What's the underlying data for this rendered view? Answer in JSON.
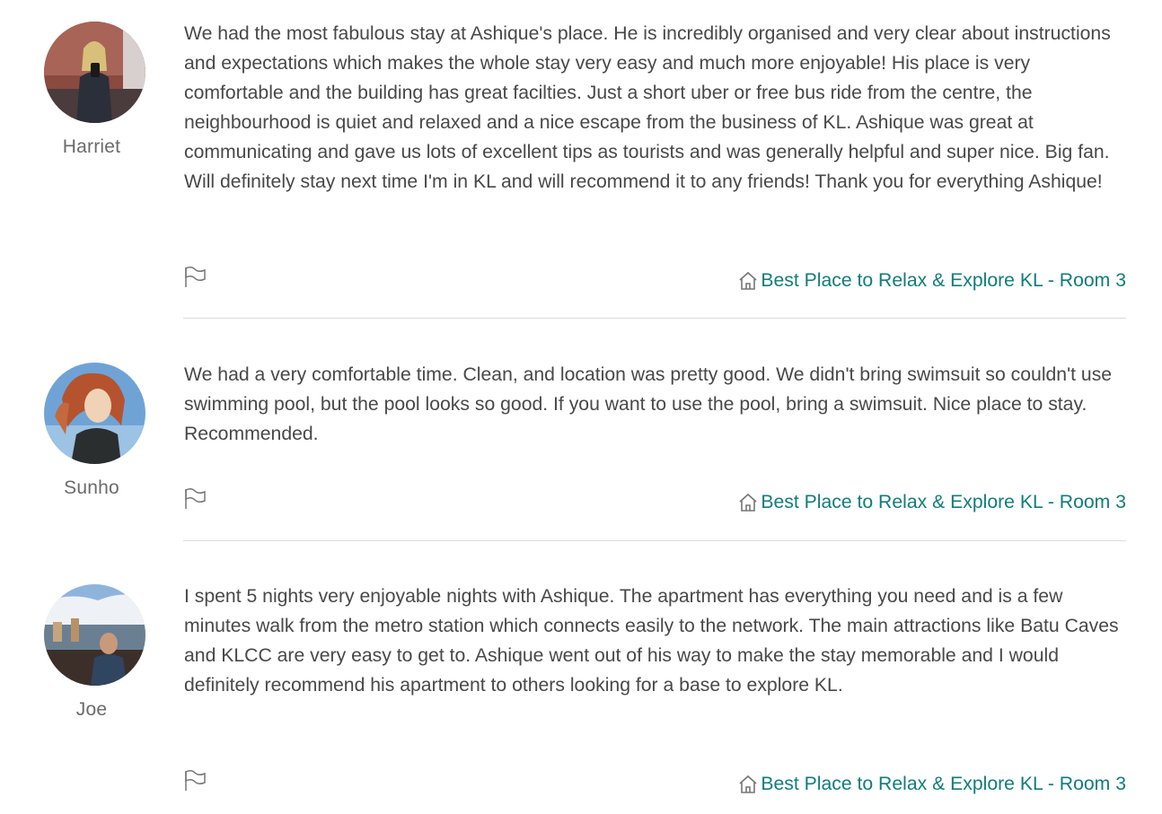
{
  "colors": {
    "text": "#484848",
    "name": "#6b6b6b",
    "link": "#127c7c",
    "divider": "#dcdcdc",
    "icon": "#767676"
  },
  "reviews": [
    {
      "reviewer": "Harriet",
      "avatar_icon": "avatar-photo",
      "text": "We had the most fabulous stay at Ashique's place. He is incredibly organised and very clear about instructions and expectations which makes the whole stay very easy and much more enjoyable! His place is very comfortable and the building has great facilties. Just a short uber or free bus ride from the centre, the neighbourhood is quiet and relaxed and a nice escape from the business of KL. Ashique was great at communicating and gave us lots of excellent tips as tourists and was generally helpful and super nice. Big fan. Will definitely stay next time I'm in KL and will recommend it to any friends! Thank you for everything Ashique!",
      "flag_icon": "flag-icon",
      "listing_icon": "home-icon",
      "listing": "Best Place to Relax & Explore KL - Room 3"
    },
    {
      "reviewer": "Sunho",
      "avatar_icon": "avatar-photo",
      "text": "We had a very comfortable time. Clean, and location was pretty good. We didn't bring swimsuit so couldn't use swimming pool, but the pool looks so good. If you want to use the pool, bring a swimsuit. Nice place to stay. Recommended.",
      "flag_icon": "flag-icon",
      "listing_icon": "home-icon",
      "listing": "Best Place to Relax & Explore KL - Room 3"
    },
    {
      "reviewer": "Joe",
      "avatar_icon": "avatar-photo",
      "text": "I spent 5 nights very enjoyable nights with Ashique. The apartment has everything you need and is a few minutes walk from the metro station which connects easily to the network. The main attractions like Batu Caves and KLCC are very easy to get to. Ashique went out of his way to make the stay memorable and I would definitely recommend his apartment to others looking for a base to explore KL.",
      "flag_icon": "flag-icon",
      "listing_icon": "home-icon",
      "listing": "Best Place to Relax & Explore KL - Room 3"
    }
  ]
}
